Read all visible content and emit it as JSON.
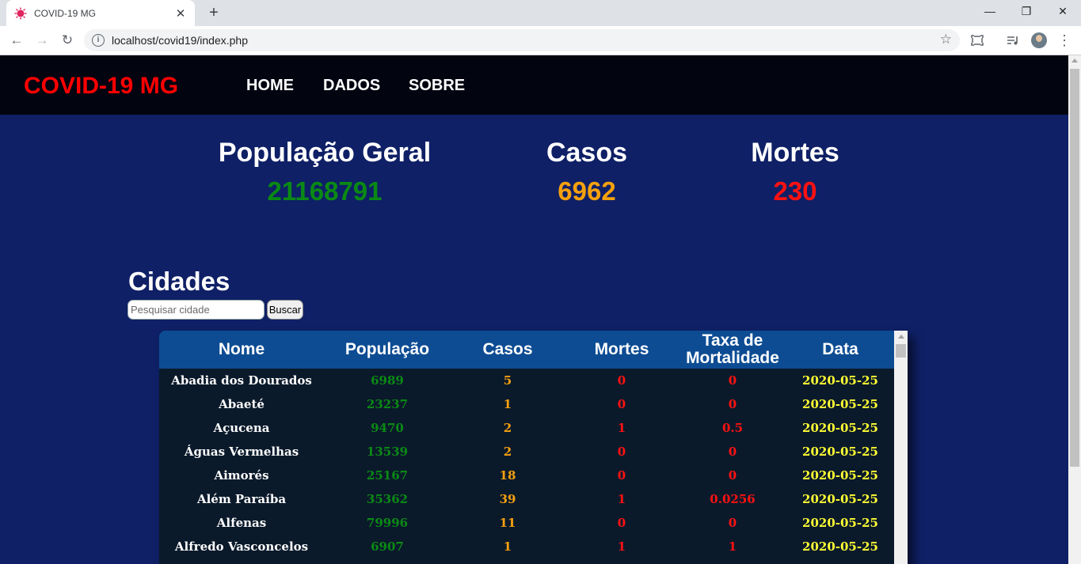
{
  "browser": {
    "tab_title": "COVID-19 MG",
    "tab_close": "✕",
    "new_tab": "+",
    "url": "localhost/covid19/index.php",
    "window_minimize": "—",
    "window_maximize": "❐",
    "window_close": "✕"
  },
  "navbar": {
    "brand": "COVID-19 MG",
    "links": [
      "HOME",
      "DADOS",
      "SOBRE"
    ]
  },
  "stats": {
    "populacao_label": "População Geral",
    "populacao_value": "21168791",
    "casos_label": "Casos",
    "casos_value": "6962",
    "mortes_label": "Mortes",
    "mortes_value": "230",
    "colors": {
      "populacao": "#0a8a14",
      "casos": "#f5a10e",
      "mortes": "#ff1111"
    }
  },
  "cidades": {
    "title": "Cidades",
    "search_placeholder": "Pesquisar cidade",
    "search_value": "",
    "search_button": "Buscar"
  },
  "table": {
    "headers": {
      "nome": "Nome",
      "populacao": "População",
      "casos": "Casos",
      "mortes": "Mortes",
      "taxa_1": "Taxa de",
      "taxa_2": "Mortalidade",
      "data": "Data"
    },
    "rows": [
      {
        "nome": "Abadia dos Dourados",
        "populacao": "6989",
        "casos": "5",
        "mortes": "0",
        "taxa": "0",
        "data": "2020-05-25"
      },
      {
        "nome": "Abaeté",
        "populacao": "23237",
        "casos": "1",
        "mortes": "0",
        "taxa": "0",
        "data": "2020-05-25"
      },
      {
        "nome": "Açucena",
        "populacao": "9470",
        "casos": "2",
        "mortes": "1",
        "taxa": "0.5",
        "data": "2020-05-25"
      },
      {
        "nome": "Águas Vermelhas",
        "populacao": "13539",
        "casos": "2",
        "mortes": "0",
        "taxa": "0",
        "data": "2020-05-25"
      },
      {
        "nome": "Aimorés",
        "populacao": "25167",
        "casos": "18",
        "mortes": "0",
        "taxa": "0",
        "data": "2020-05-25"
      },
      {
        "nome": "Além Paraíba",
        "populacao": "35362",
        "casos": "39",
        "mortes": "1",
        "taxa": "0.0256",
        "data": "2020-05-25"
      },
      {
        "nome": "Alfenas",
        "populacao": "79996",
        "casos": "11",
        "mortes": "0",
        "taxa": "0",
        "data": "2020-05-25"
      },
      {
        "nome": "Alfredo Vasconcelos",
        "populacao": "6907",
        "casos": "1",
        "mortes": "1",
        "taxa": "1",
        "data": "2020-05-25"
      }
    ]
  }
}
